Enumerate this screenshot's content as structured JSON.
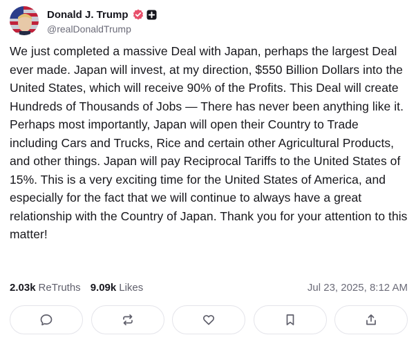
{
  "post": {
    "author": {
      "display_name": "Donald J. Trump",
      "handle": "@realDonaldTrump",
      "avatar_icon": "avatar-portrait",
      "verified_icon": "verified-badge-icon",
      "verified_color": "#e8506b"
    },
    "text": "We just completed a massive Deal with Japan, perhaps the largest Deal ever made. Japan will invest, at my direction, $550 Billion Dollars into the United States, which will receive 90% of the Profits. This Deal will create Hundreds of Thousands of Jobs — There has never been anything like it. Perhaps most importantly, Japan will open their Country to Trade including Cars and Trucks, Rice and certain other Agricultural Products, and other things. Japan will pay Reciprocal Tariffs to the United States of 15%. This is a very exciting time for the United States of America, and especially for the fact that we will continue to always have a great relationship with the Country of Japan. Thank you for your attention to this matter!",
    "stats": {
      "retruths_count": "2.03k",
      "retruths_label": "ReTruths",
      "likes_count": "9.09k",
      "likes_label": "Likes"
    },
    "timestamp": "Jul 23, 2025, 8:12 AM",
    "actions": [
      {
        "name": "reply-button",
        "icon": "comment-icon"
      },
      {
        "name": "retruth-button",
        "icon": "repost-icon"
      },
      {
        "name": "like-button",
        "icon": "heart-icon"
      },
      {
        "name": "bookmark-button",
        "icon": "bookmark-icon"
      },
      {
        "name": "share-button",
        "icon": "share-icon"
      }
    ]
  }
}
